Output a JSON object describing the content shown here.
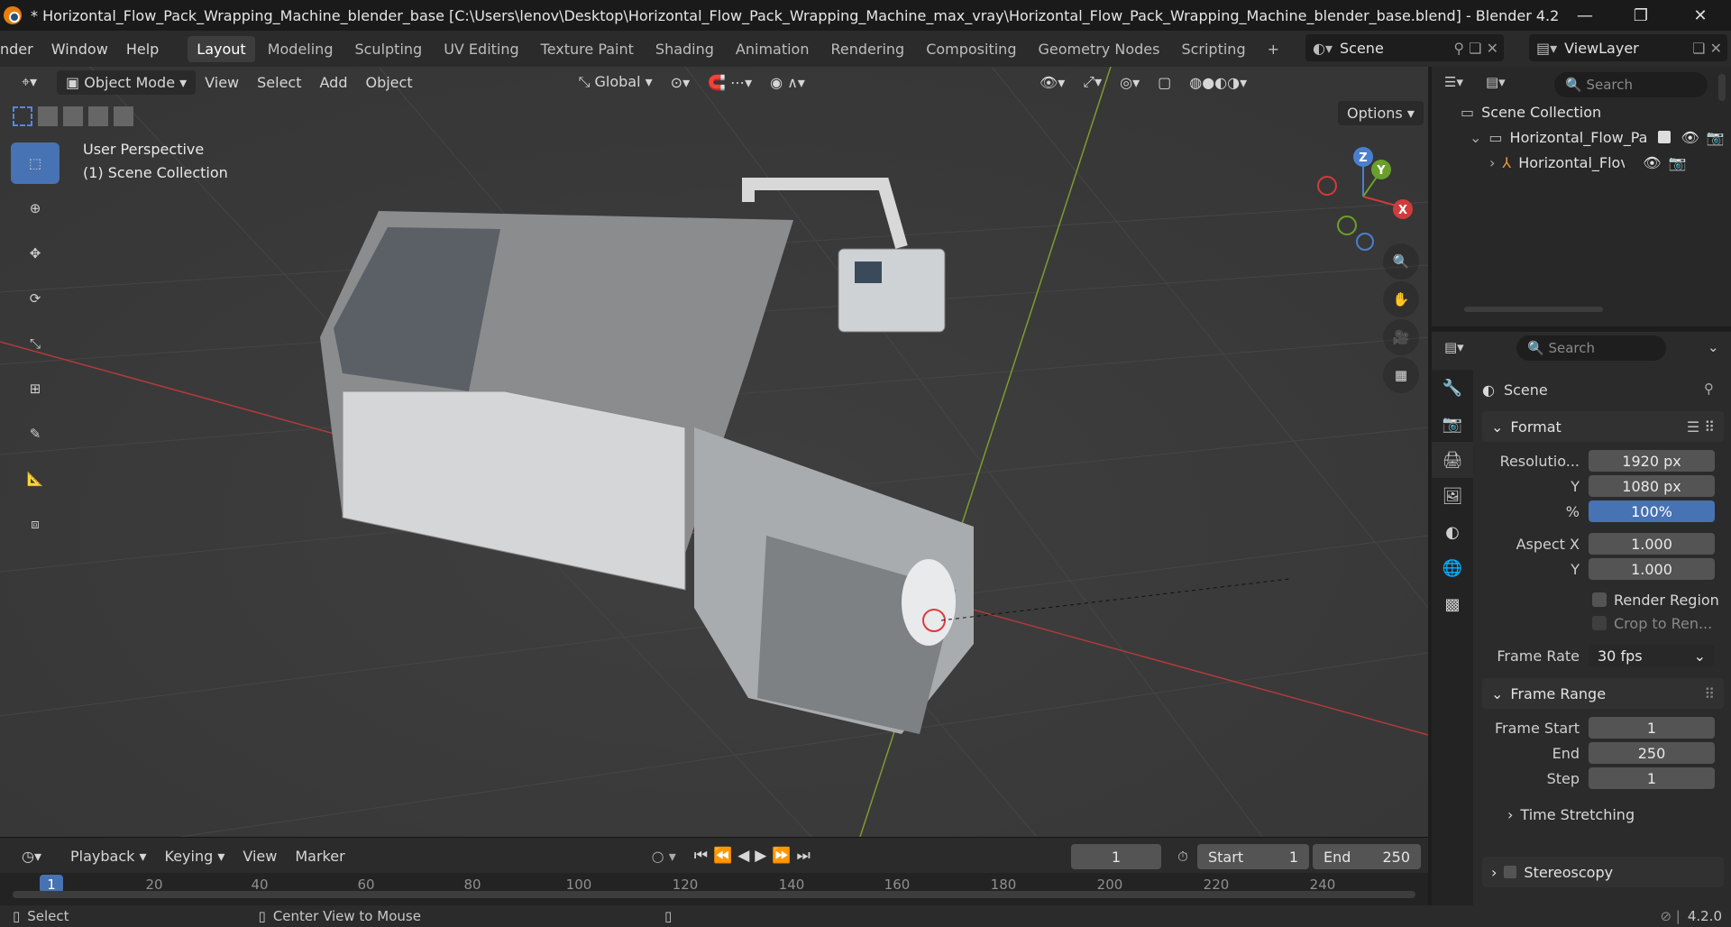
{
  "window": {
    "title": "* Horizontal_Flow_Pack_Wrapping_Machine_blender_base [C:\\Users\\lenov\\Desktop\\Horizontal_Flow_Pack_Wrapping_Machine_max_vray\\Horizontal_Flow_Pack_Wrapping_Machine_blender_base.blend] - Blender 4.2",
    "minimize": "—",
    "maximize": "❐",
    "close": "✕"
  },
  "menu": [
    "nder",
    "Window",
    "Help"
  ],
  "workspaces": [
    "Layout",
    "Modeling",
    "Sculpting",
    "UV Editing",
    "Texture Paint",
    "Shading",
    "Animation",
    "Rendering",
    "Compositing",
    "Geometry Nodes",
    "Scripting"
  ],
  "scene": {
    "name": "Scene",
    "view_layer": "ViewLayer"
  },
  "viewport": {
    "mode": "Object Mode",
    "menus": [
      "View",
      "Select",
      "Add",
      "Object"
    ],
    "transform": "Global",
    "options": "Options",
    "perspective": "User Perspective",
    "collection": "(1) Scene Collection",
    "gizmo": {
      "z": "Z",
      "y": "Y",
      "x": "X"
    }
  },
  "outliner": {
    "search_placeholder": "Search",
    "root": "Scene Collection",
    "items": [
      {
        "label": "Horizontal_Flow_Pa"
      },
      {
        "label": "Horizontal_Flov"
      }
    ]
  },
  "properties": {
    "search_placeholder": "Search",
    "context": "Scene",
    "format": {
      "title": "Format",
      "resolution_label": "Resolutio...",
      "res_x": "1920 px",
      "y_label": "Y",
      "res_y": "1080 px",
      "pct_label": "%",
      "pct": "100%",
      "aspect_label": "Aspect X",
      "aspect_x": "1.000",
      "aspect_y_label": "Y",
      "aspect_y": "1.000",
      "render_region": "Render Region",
      "crop": "Crop to Ren...",
      "frame_rate_label": "Frame Rate",
      "frame_rate": "30 fps"
    },
    "frame_range": {
      "title": "Frame Range",
      "start_label": "Frame Start",
      "start": "1",
      "end_label": "End",
      "end": "250",
      "step_label": "Step",
      "step": "1"
    },
    "time_stretching": "Time Stretching",
    "stereoscopy": "Stereoscopy"
  },
  "timeline": {
    "menus": [
      "Playback",
      "Keying",
      "View",
      "Marker"
    ],
    "current_frame": "1",
    "start_label": "Start",
    "start": "1",
    "end_label": "End",
    "end": "250",
    "ticks": [
      "1",
      "20",
      "40",
      "60",
      "80",
      "100",
      "120",
      "140",
      "160",
      "180",
      "200",
      "220",
      "240"
    ]
  },
  "status": {
    "select": "Select",
    "center_view": "Center View to Mouse",
    "version": "4.2.0"
  }
}
